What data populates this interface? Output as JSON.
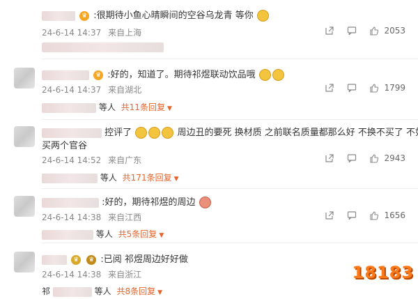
{
  "colors": {
    "accent": "#e8632a",
    "meta": "#888888",
    "emoji": "#f3c43e"
  },
  "comments": [
    {
      "text": ":很期待小鱼心晴瞬间的空谷乌龙青 等你",
      "date": "24-6-14 14:37",
      "location": "来自上海",
      "likes": "2053"
    },
    {
      "text": ":好的，知道了。期待祁煜联动饮品哦",
      "date": "24-6-14 14:37",
      "location": "来自湖北",
      "likes": "1799",
      "replies": {
        "who": "等人",
        "more": "共11条回复"
      }
    },
    {
      "text": "控评了",
      "text_b": "周边丑的要死 换材质 之前联名质量都那么好 不换不买了 不如多",
      "text2": "买两个官谷",
      "date": "24-6-14 14:52",
      "location": "来自广东",
      "likes": "2943",
      "replies": {
        "who": "等人",
        "more": "共171条回复"
      }
    },
    {
      "text": ":好的，期待祁煜的周边",
      "date": "24-6-14 14:38",
      "location": "来自江西",
      "likes": "1656",
      "replies": {
        "who": "等人",
        "more": "共5条回复"
      }
    },
    {
      "text": ":已阅 祁煜周边好好做",
      "date": "24-6-14 14:38",
      "location": "来自浙江",
      "replies": {
        "prefix": "祁",
        "who": "等人",
        "more": "共8条回复"
      }
    }
  ],
  "watermark": "18183"
}
